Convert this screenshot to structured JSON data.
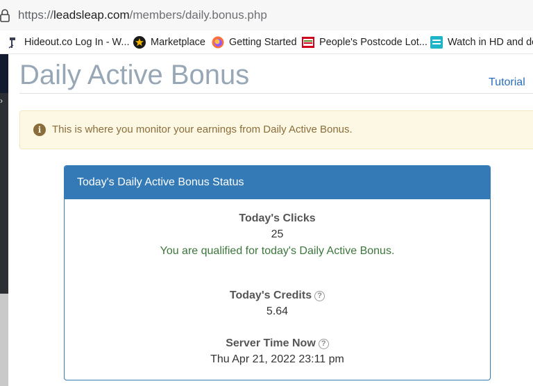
{
  "browser": {
    "url_scheme": "https://",
    "url_host": "leadsleap.com",
    "url_path": "/members/daily.bonus.php",
    "bookmarks": [
      {
        "label": "Hideout.co Log In - W...",
        "icon": "hideout-icon"
      },
      {
        "label": "Marketplace",
        "icon": "marketplace-star-icon"
      },
      {
        "label": "Getting Started",
        "icon": "firefox-icon"
      },
      {
        "label": "People's Postcode Lot...",
        "icon": "postcode-lottery-icon"
      },
      {
        "label": "Watch in HD and do",
        "icon": "erosnow-icon"
      }
    ]
  },
  "page": {
    "title": "Daily Active Bonus",
    "tutorial_link": "Tutorial",
    "alert_text": "This is where you monitor your earnings from Daily Active Bonus."
  },
  "panel": {
    "heading": "Today's Daily Active Bonus Status",
    "clicks_label": "Today's Clicks",
    "clicks_value": "25",
    "qualified_text": "You are qualified for today's Daily Active Bonus.",
    "credits_label": "Today's Credits",
    "credits_value": "5.64",
    "server_time_label": "Server Time Now",
    "server_time_value": "Thu Apr 21, 2022 23:11 pm"
  },
  "colors": {
    "panel_primary": "#337ab7",
    "alert_bg": "#fcf8e3",
    "alert_text": "#8a6d3b",
    "success_text": "#3c763d",
    "title_text": "#98a7b6",
    "link": "#2a6ebb"
  }
}
